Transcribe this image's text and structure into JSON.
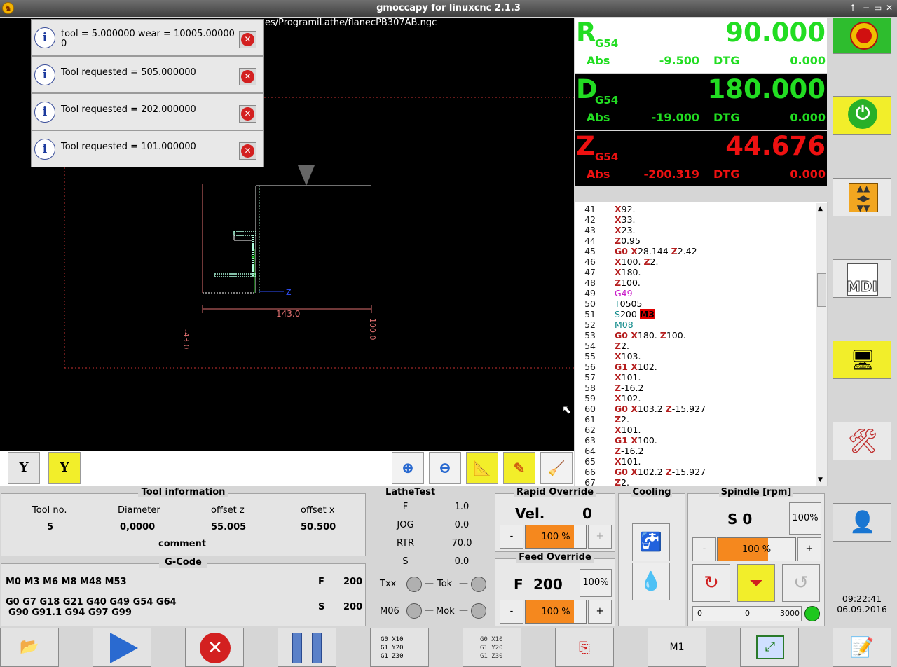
{
  "window": {
    "title": "gmoccapy for linuxcnc  2.1.3",
    "controls": [
      "↑",
      "−",
      "▭",
      "✕"
    ]
  },
  "preview": {
    "file_path": "es/ProgramiLathe/flanecPB307AB.ngc"
  },
  "messages": [
    {
      "text": "tool = 5.000000 wear = 10005.00000 0"
    },
    {
      "text": "Tool requested = 505.000000"
    },
    {
      "text": "Tool requested = 202.000000"
    },
    {
      "text": "Tool requested = 101.000000"
    }
  ],
  "dimensions": {
    "width_label": "143.0",
    "left_label": "-43.0",
    "right_label": "100.0"
  },
  "dro": [
    {
      "letter": "R",
      "system": "G54",
      "value": "90.000",
      "abs_label": "Abs",
      "abs": "-9.500",
      "dtg_label": "DTG",
      "dtg": "0.000",
      "color": "#22dd22"
    },
    {
      "letter": "D",
      "system": "G54",
      "value": "180.000",
      "abs_label": "Abs",
      "abs": "-19.000",
      "dtg_label": "DTG",
      "dtg": "0.000",
      "color": "#22dd22"
    },
    {
      "letter": "Z",
      "system": "G54",
      "value": "44.676",
      "abs_label": "Abs",
      "abs": "-200.319",
      "dtg_label": "DTG",
      "dtg": "0.000",
      "color": "#ee1111"
    }
  ],
  "gcode": [
    {
      "n": "41",
      "p": [
        [
          "w",
          "X"
        ],
        [
          "",
          "92."
        ]
      ]
    },
    {
      "n": "42",
      "p": [
        [
          "w",
          "X"
        ],
        [
          "",
          "33."
        ]
      ]
    },
    {
      "n": "43",
      "p": [
        [
          "w",
          "X"
        ],
        [
          "",
          "23."
        ]
      ]
    },
    {
      "n": "44",
      "p": [
        [
          "w",
          "Z"
        ],
        [
          "",
          "0.95"
        ]
      ]
    },
    {
      "n": "45",
      "p": [
        [
          "w",
          "G0 X"
        ],
        [
          "",
          "28.144 "
        ],
        [
          "w",
          "Z"
        ],
        [
          "",
          "2.42"
        ]
      ]
    },
    {
      "n": "46",
      "p": [
        [
          "w",
          "X"
        ],
        [
          "",
          "100. "
        ],
        [
          "w",
          "Z"
        ],
        [
          "",
          "2."
        ]
      ]
    },
    {
      "n": "47",
      "p": [
        [
          "w",
          "X"
        ],
        [
          "",
          "180."
        ]
      ]
    },
    {
      "n": "48",
      "p": [
        [
          "w",
          "Z"
        ],
        [
          "",
          "100."
        ]
      ]
    },
    {
      "n": "49",
      "p": [
        [
          "pk",
          "G49"
        ]
      ]
    },
    {
      "n": "50",
      "p": [
        [
          "tl",
          "T"
        ],
        [
          "",
          "0505"
        ]
      ]
    },
    {
      "n": "51",
      "p": [
        [
          "tl",
          "S"
        ],
        [
          "",
          "200 "
        ],
        [
          "hl",
          "M3"
        ]
      ]
    },
    {
      "n": "52",
      "p": [
        [
          "tl",
          "M08"
        ]
      ]
    },
    {
      "n": "53",
      "p": [
        [
          "w",
          "G0 X"
        ],
        [
          "",
          "180. "
        ],
        [
          "w",
          "Z"
        ],
        [
          "",
          "100."
        ]
      ]
    },
    {
      "n": "54",
      "p": [
        [
          "w",
          "Z"
        ],
        [
          "",
          "2."
        ]
      ]
    },
    {
      "n": "55",
      "p": [
        [
          "w",
          "X"
        ],
        [
          "",
          "103."
        ]
      ]
    },
    {
      "n": "56",
      "p": [
        [
          "w",
          "G1 X"
        ],
        [
          "",
          "102."
        ]
      ]
    },
    {
      "n": "57",
      "p": [
        [
          "w",
          "X"
        ],
        [
          "",
          "101."
        ]
      ]
    },
    {
      "n": "58",
      "p": [
        [
          "w",
          "Z"
        ],
        [
          "",
          "-16.2"
        ]
      ]
    },
    {
      "n": "59",
      "p": [
        [
          "w",
          "X"
        ],
        [
          "",
          "102."
        ]
      ]
    },
    {
      "n": "60",
      "p": [
        [
          "w",
          "G0 X"
        ],
        [
          "",
          "103.2 "
        ],
        [
          "w",
          "Z"
        ],
        [
          "",
          "-15.927"
        ]
      ]
    },
    {
      "n": "61",
      "p": [
        [
          "w",
          "Z"
        ],
        [
          "",
          "2."
        ]
      ]
    },
    {
      "n": "62",
      "p": [
        [
          "w",
          "X"
        ],
        [
          "",
          "101."
        ]
      ]
    },
    {
      "n": "63",
      "p": [
        [
          "w",
          "G1 X"
        ],
        [
          "",
          "100."
        ]
      ]
    },
    {
      "n": "64",
      "p": [
        [
          "w",
          "Z"
        ],
        [
          "",
          "-16.2"
        ]
      ]
    },
    {
      "n": "65",
      "p": [
        [
          "w",
          "X"
        ],
        [
          "",
          "101."
        ]
      ]
    },
    {
      "n": "66",
      "p": [
        [
          "w",
          "G0 X"
        ],
        [
          "",
          "102.2 "
        ],
        [
          "w",
          "Z"
        ],
        [
          "",
          "-15.927"
        ]
      ]
    },
    {
      "n": "67",
      "p": [
        [
          "w",
          "Z"
        ],
        [
          "",
          "2."
        ]
      ]
    }
  ],
  "side": {
    "mdi_label": "MDI"
  },
  "tool_info": {
    "title": "Tool information",
    "headers": [
      "Tool no.",
      "Diameter",
      "offset z",
      "offset x"
    ],
    "values": [
      "5",
      "0,0000",
      "55.005",
      "50.500"
    ],
    "comment_label": "comment"
  },
  "gcode_info": {
    "title": "G-Code",
    "mcodes": "M0 M3 M6 M8 M48 M53",
    "gcodes_line1": "G0 G7 G18 G21 G40 G49 G54 G64",
    "gcodes_line2": "G90 G91.1 G94 G97 G99",
    "f_label": "F",
    "f_value": "200",
    "s_label": "S",
    "s_value": "200"
  },
  "lathetest": {
    "title": "LatheTest",
    "rows": [
      {
        "label": "F",
        "value": "1.0"
      },
      {
        "label": "JOG",
        "value": "0.0"
      },
      {
        "label": "RTR",
        "value": "70.0"
      },
      {
        "label": "S",
        "value": "0.0"
      }
    ],
    "leds": [
      "Txx",
      "Tok",
      "M06",
      "Mok"
    ]
  },
  "rapid": {
    "title": "Rapid Override",
    "vel_label": "Vel.",
    "vel_value": "0",
    "minus": "-",
    "plus": "+",
    "percent": "100 %",
    "fraction": 0.8
  },
  "feed": {
    "title": "Feed Override",
    "f_label": "F",
    "f_value": "200",
    "reset": "100%",
    "minus": "-",
    "plus": "+",
    "percent": "100 %",
    "fraction": 0.8
  },
  "cooling": {
    "title": "Cooling"
  },
  "spindle": {
    "title": "Spindle [rpm]",
    "s_text": "S 0",
    "reset": "100%",
    "minus": "-",
    "plus": "+",
    "percent": "100 %",
    "fraction": 0.65,
    "bar_min": "0",
    "bar_value": "0",
    "bar_max": "3000"
  },
  "clock": {
    "time": "09:22:41",
    "date": "06.09.2016"
  },
  "bottom": {
    "m1_label": "M1"
  }
}
